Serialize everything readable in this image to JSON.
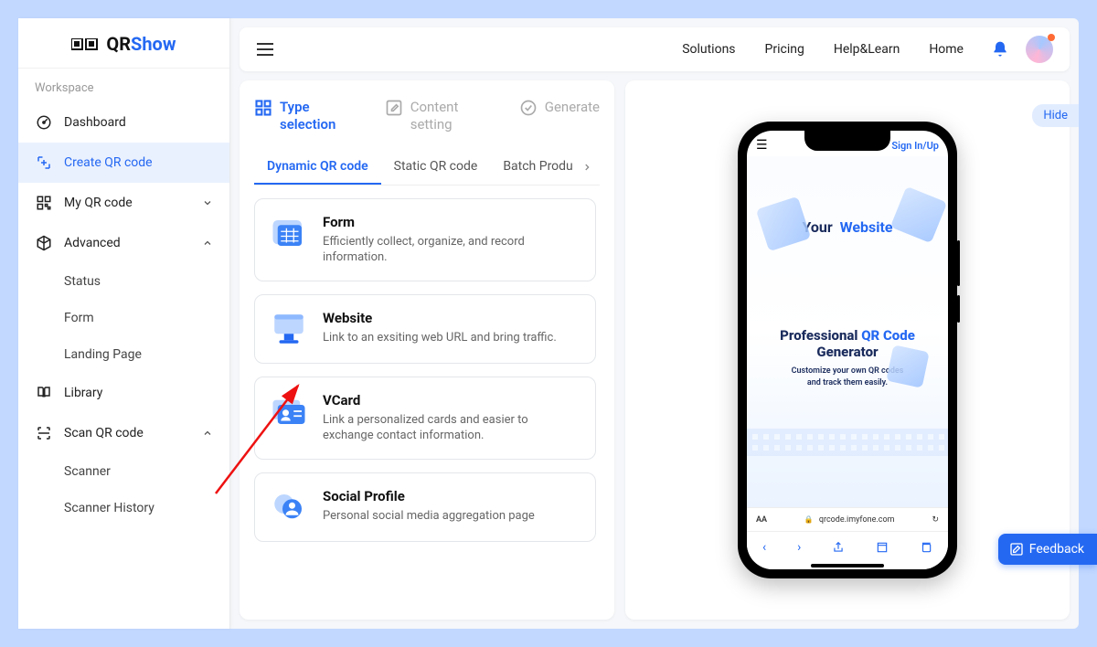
{
  "brand": {
    "prefix": "QR",
    "suffix": "Show"
  },
  "sidebar": {
    "workspace_label": "Workspace",
    "items": [
      {
        "label": "Dashboard"
      },
      {
        "label": "Create QR code"
      },
      {
        "label": "My QR code"
      },
      {
        "label": "Advanced"
      },
      {
        "label": "Library"
      },
      {
        "label": "Scan QR code"
      }
    ],
    "advanced_sub": [
      {
        "label": "Status"
      },
      {
        "label": "Form"
      },
      {
        "label": "Landing Page"
      }
    ],
    "scan_sub": [
      {
        "label": "Scanner"
      },
      {
        "label": "Scanner History"
      }
    ]
  },
  "topbar": {
    "links": [
      {
        "label": "Solutions"
      },
      {
        "label": "Pricing"
      },
      {
        "label": "Help&Learn"
      },
      {
        "label": "Home"
      }
    ]
  },
  "steps": [
    {
      "label": "Type selection",
      "active": true
    },
    {
      "label": "Content setting",
      "active": false
    },
    {
      "label": "Generate",
      "active": false
    }
  ],
  "tabs": [
    {
      "label": "Dynamic QR code",
      "active": true
    },
    {
      "label": "Static QR code",
      "active": false
    },
    {
      "label": "Batch Produ",
      "active": false
    }
  ],
  "cards": [
    {
      "title": "Form",
      "desc": "Efficiently collect, organize, and record information."
    },
    {
      "title": "Website",
      "desc": "Link to an exsiting web URL and bring traffic."
    },
    {
      "title": "VCard",
      "desc": "Link a personalized cards and easier to exchange contact information."
    },
    {
      "title": "Social Profile",
      "desc": "Personal social media aggregation page"
    }
  ],
  "preview": {
    "signin": "Sign In/Up",
    "hero_prefix": "Your",
    "hero_highlight": "Website",
    "headline_prefix": "Professional",
    "headline_highlight": "QR Code",
    "headline_suffix": "Generator",
    "subline1": "Customize your own QR codes",
    "subline2": "and track them easily.",
    "url": "qrcode.imyfone.com",
    "aa": "AA"
  },
  "hide_label": "Hide",
  "feedback_label": "Feedback"
}
